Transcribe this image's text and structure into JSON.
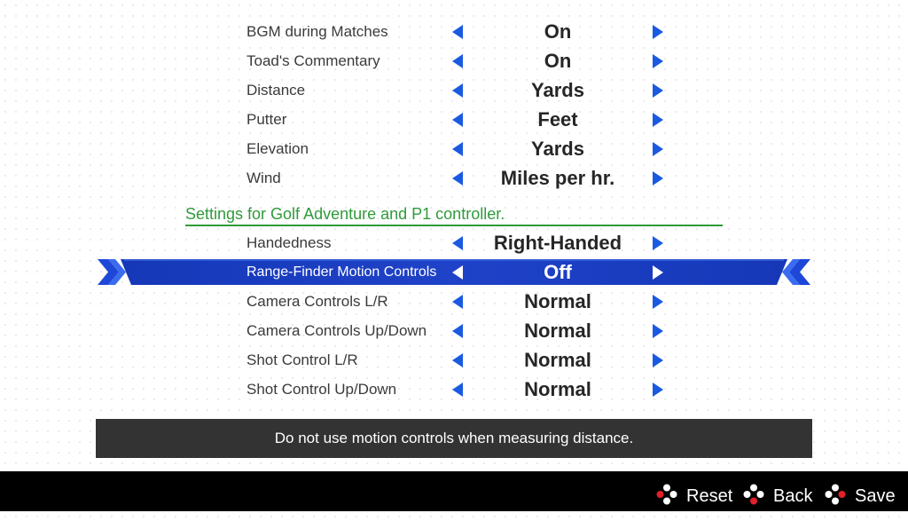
{
  "settings": [
    {
      "label": "BGM during Matches",
      "value": "On"
    },
    {
      "label": "Toad's Commentary",
      "value": "On"
    },
    {
      "label": "Distance",
      "value": "Yards"
    },
    {
      "label": "Putter",
      "value": "Feet"
    },
    {
      "label": "Elevation",
      "value": "Yards"
    },
    {
      "label": "Wind",
      "value": "Miles per hr."
    }
  ],
  "section": {
    "title": "Settings for Golf Adventure and P1 controller."
  },
  "controller_settings": [
    {
      "label": "Handedness",
      "value": "Right-Handed"
    },
    {
      "label": "Range-Finder Motion Controls",
      "value": "Off"
    },
    {
      "label": "Camera Controls L/R",
      "value": "Normal"
    },
    {
      "label": "Camera Controls Up/Down",
      "value": "Normal"
    },
    {
      "label": "Shot Control L/R",
      "value": "Normal"
    },
    {
      "label": "Shot Control Up/Down",
      "value": "Normal"
    }
  ],
  "selected": "Range-Finder Motion Controls",
  "description": "Do not use motion controls when measuring distance.",
  "footer": {
    "reset": "Reset",
    "back": "Back",
    "save": "Save"
  },
  "colors": {
    "accent": "#1a5ae0",
    "selection": "#1d3fc4",
    "section": "#2f9a3a",
    "description_bg": "#333333",
    "footer_bg": "#000000",
    "button_dot_active": "#e0202a"
  },
  "icons": {
    "left": "caret-left-icon",
    "right": "caret-right-icon",
    "controller_buttons": "controller-buttons-icon"
  }
}
